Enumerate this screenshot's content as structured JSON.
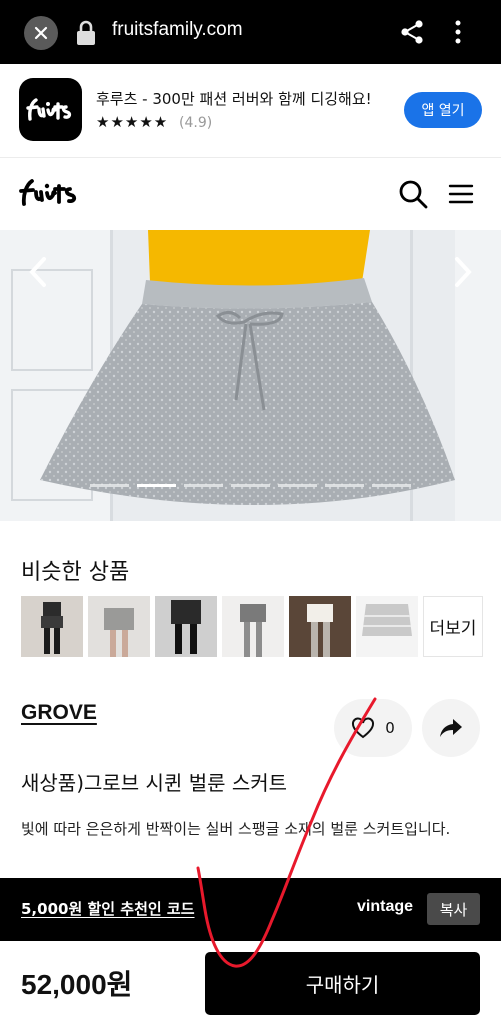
{
  "browser": {
    "url": "fruitsfamily.com"
  },
  "app_banner": {
    "title": "후루츠 - 300만 패션 러버와 함께 디깅해요!",
    "stars": "★★★★★",
    "rating": "(4.9)",
    "open_label": "앱 열기"
  },
  "site_header": {
    "logo": "fruits"
  },
  "similar": {
    "title": "비슷한 상품",
    "more_label": "더보기"
  },
  "product": {
    "brand": "GROVE",
    "like_count": "0",
    "name": "새상품)그로브 시퀸 벌룬 스커트",
    "description": "빛에 따라 은은하게 반짝이는 실버 스팽글 소재의 벌룬 스커트입니다."
  },
  "promo": {
    "text": "5,000원 할인 추천인 코드",
    "code": "vintage",
    "copy_label": "복사"
  },
  "buy": {
    "price": "52,000원",
    "button_label": "구매하기"
  },
  "colors": {
    "accent_blue": "#1a73e8",
    "black": "#000000",
    "annotation_red": "#e8192c"
  }
}
